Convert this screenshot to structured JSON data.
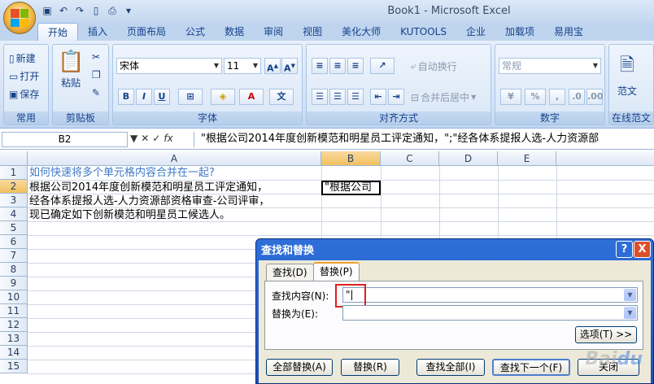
{
  "window": {
    "title": "Book1 - Microsoft Excel"
  },
  "tabs": [
    "开始",
    "插入",
    "页面布局",
    "公式",
    "数据",
    "审阅",
    "视图",
    "美化大师",
    "KUTOOLS",
    "企业",
    "加载项",
    "易用宝"
  ],
  "ribbon": {
    "common": {
      "new": "新建",
      "open": "打开",
      "save": "保存",
      "group": "常用"
    },
    "clipboard": {
      "paste": "粘贴",
      "group": "剪贴板"
    },
    "font": {
      "name": "宋体",
      "size": "11",
      "group": "字体",
      "bold": "B",
      "italic": "I",
      "underline": "U"
    },
    "align": {
      "wrap": "自动换行",
      "merge": "合并后居中",
      "group": "对齐方式"
    },
    "number": {
      "format": "常规",
      "percent": "%",
      "comma": ",",
      "group": "数字"
    },
    "essay": {
      "label": "范文",
      "group": "在线范文"
    }
  },
  "formula_bar": {
    "name_box": "B2",
    "fx": "fx",
    "content": "\"根据公司2014年度创新模范和明星员工评定通知，\";\"经各体系提报人选-人力资源部"
  },
  "sheet": {
    "columns": [
      "A",
      "B",
      "C",
      "D",
      "E"
    ],
    "rows": [
      "1",
      "2",
      "3",
      "4",
      "5",
      "6",
      "7",
      "8",
      "9",
      "10",
      "11",
      "12",
      "13",
      "14",
      "15"
    ],
    "a1": "如何快速将多个单元格内容合并在一起?",
    "a2": "根据公司2014年度创新模范和明星员工评定通知，",
    "a3": "经各体系提报人选-人力资源部资格审查-公司评审，",
    "a4": "现已确定如下创新模范和明星员工候选人。",
    "b2": "\"根据公司"
  },
  "dialog": {
    "title": "查找和替换",
    "help": "?",
    "close": "X",
    "tab_find": "查找(D)",
    "tab_replace": "替换(P)",
    "find_label": "查找内容(N):",
    "find_value": "\"|",
    "replace_label": "替换为(E):",
    "replace_value": "",
    "options": "选项(T) >>",
    "replace_all": "全部替换(A)",
    "replace": "替换(R)",
    "find_all": "查找全部(I)",
    "find_next": "查找下一个(F)",
    "close_btn": "关闭"
  },
  "watermark": "Baidu经验"
}
